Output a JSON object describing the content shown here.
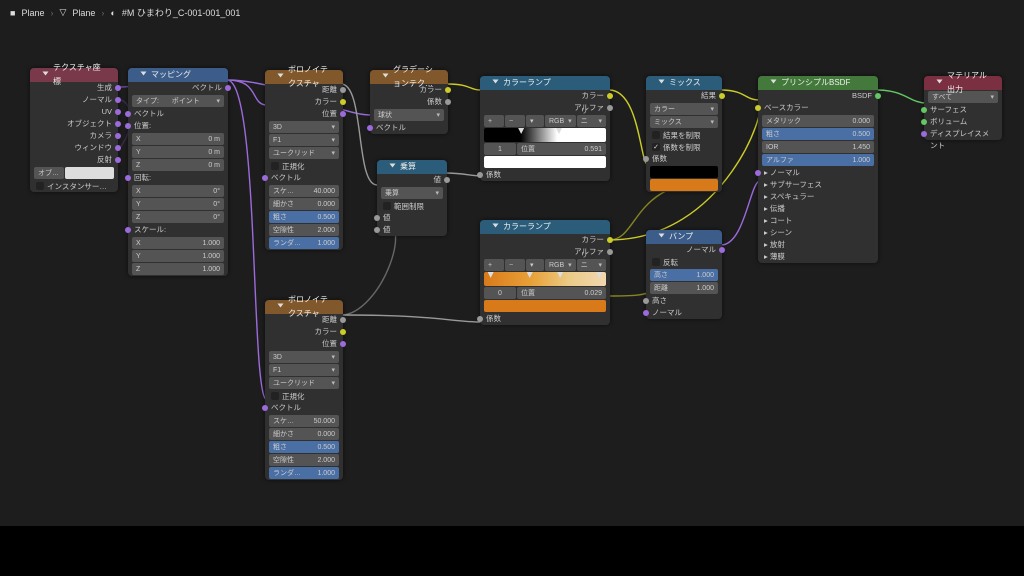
{
  "crumbs": [
    "Plane",
    "Plane",
    "#M ひまわり_C-001-001_001"
  ],
  "texcoord": {
    "title": "テクスチャ座標",
    "outs": [
      "生成",
      "ノーマル",
      "UV",
      "オブジェクト",
      "カメラ",
      "ウィンドウ",
      "反射"
    ],
    "obj": "オブ…",
    "inst": "インスタンサー…"
  },
  "mapping": {
    "title": "マッピング",
    "out": "ベクトル",
    "type_l": "タイプ:",
    "type": "ポイント",
    "vec": "ベクトル",
    "loc": "位置:",
    "rot": "回転:",
    "scale": "スケール:",
    "xyz": [
      "X",
      "Y",
      "Z"
    ],
    "loc_v": [
      "0 m",
      "0 m",
      "0 m"
    ],
    "rot_v": [
      "0°",
      "0°",
      "0°"
    ],
    "scale_v": [
      "1.000",
      "1.000",
      "1.000"
    ]
  },
  "voronoi1": {
    "title": "ボロノイテクスチャ",
    "outs": [
      "距離",
      "カラー",
      "位置"
    ],
    "dim": "3D",
    "f": "F1",
    "dist": "ユークリッド",
    "norm": "正規化",
    "vec": "ベクトル",
    "rows": [
      [
        "スケ…",
        "40.000"
      ],
      [
        "細かさ",
        "0.000"
      ],
      [
        "粗さ",
        "0.500",
        true
      ],
      [
        "空隙性",
        "2.000"
      ],
      [
        "ランダ…",
        "1.000",
        true
      ]
    ]
  },
  "voronoi2": {
    "title": "ボロノイテクスチャ",
    "rows": [
      [
        "スケ…",
        "50.000"
      ],
      [
        "細かさ",
        "0.000"
      ],
      [
        "粗さ",
        "0.500",
        true
      ],
      [
        "空隙性",
        "2.000"
      ],
      [
        "ランダ…",
        "1.000",
        true
      ]
    ]
  },
  "grad": {
    "title": "グラデーションテク…",
    "outs": [
      "カラー",
      "係数"
    ],
    "type": "球状",
    "vec": "ベクトル"
  },
  "mul": {
    "title": "乗算",
    "out": "値",
    "op": "乗算",
    "clamp": "範囲制限",
    "in": "値"
  },
  "cr1": {
    "title": "カラーランプ",
    "outs": [
      "カラー",
      "アルファ"
    ],
    "mode": [
      "RGB",
      "リニア"
    ],
    "row": [
      "1",
      "位置",
      "0.591"
    ],
    "in": "係数"
  },
  "cr2": {
    "title": "カラーランプ",
    "row": [
      "0",
      "位置",
      "0.029"
    ]
  },
  "mix": {
    "title": "ミックス",
    "out": "結果",
    "sel": [
      "カラー",
      "ミックス"
    ],
    "c1": "結果を制限",
    "c2": "係数を制限",
    "in": "係数"
  },
  "bump": {
    "title": "バンプ",
    "out": "ノーマル",
    "inv": "反転",
    "rows": [
      [
        "高さ",
        "1.000",
        true
      ],
      [
        "距離",
        "1.000"
      ]
    ],
    "ins": [
      "高さ",
      "ノーマル"
    ]
  },
  "bsdf": {
    "title": "プリンシプルBSDF",
    "out": "BSDF",
    "base": "ベースカラー",
    "rows": [
      [
        "メタリック",
        "0.000"
      ],
      [
        "粗さ",
        "0.500",
        true
      ],
      [
        "IOR",
        "1.450"
      ],
      [
        "アルファ",
        "1.000",
        true
      ]
    ],
    "cats": [
      "ノーマル",
      "サブサーフェス",
      "スペキュラー",
      "伝播",
      "コート",
      "シーン",
      "放射",
      "薄膜"
    ]
  },
  "out": {
    "title": "マテリアル出力",
    "all": "すべて",
    "ins": [
      "サーフェス",
      "ボリューム",
      "ディスプレイスメント"
    ]
  }
}
